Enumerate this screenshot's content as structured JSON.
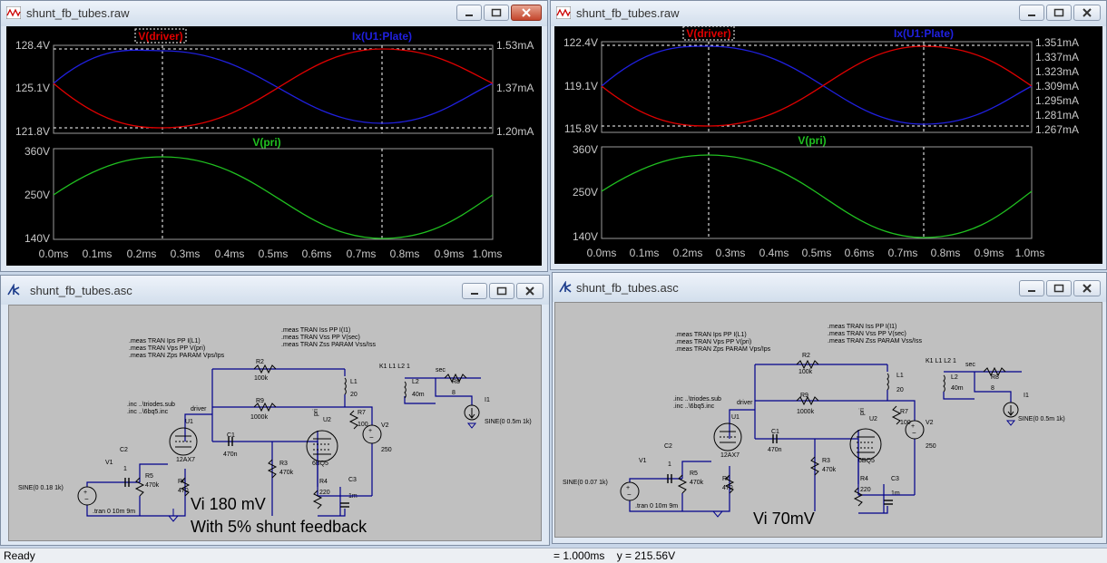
{
  "windows": {
    "wave_left": {
      "title": "shunt_fb_tubes.raw",
      "top": {
        "left_trace": "V(driver)",
        "right_trace": "Ix(U1:Plate)",
        "left_ticks": [
          "128.4V",
          "125.1V",
          "121.8V"
        ],
        "right_ticks": [
          "1.53mA",
          "1.37mA",
          "1.20mA"
        ]
      },
      "bottom": {
        "trace": "V(pri)",
        "left_ticks": [
          "360V",
          "250V",
          "140V"
        ]
      },
      "x_ticks": [
        "0.0ms",
        "0.1ms",
        "0.2ms",
        "0.3ms",
        "0.4ms",
        "0.5ms",
        "0.6ms",
        "0.7ms",
        "0.8ms",
        "0.9ms",
        "1.0ms"
      ]
    },
    "wave_right": {
      "title": "shunt_fb_tubes.raw",
      "top": {
        "left_trace": "V(driver)",
        "right_trace": "Ix(U1:Plate)",
        "left_ticks": [
          "122.4V",
          "119.1V",
          "115.8V"
        ],
        "right_ticks": [
          "1.351mA",
          "1.337mA",
          "1.323mA",
          "1.309mA",
          "1.295mA",
          "1.281mA",
          "1.267mA"
        ]
      },
      "bottom": {
        "trace": "V(pri)",
        "left_ticks": [
          "360V",
          "250V",
          "140V"
        ]
      },
      "x_ticks": [
        "0.0ms",
        "0.1ms",
        "0.2ms",
        "0.3ms",
        "0.4ms",
        "0.5ms",
        "0.6ms",
        "0.7ms",
        "0.8ms",
        "0.9ms",
        "1.0ms"
      ]
    },
    "sch_left": {
      "title": "shunt_fb_tubes.asc",
      "meas1": [
        ".meas TRAN Ips PP I(L1)",
        ".meas TRAN Vps PP V(pri)",
        ".meas TRAN Zps PARAM Vps/Ips"
      ],
      "meas2": [
        ".meas TRAN Iss PP I(I1)",
        ".meas TRAN Vss PP V(sec)",
        ".meas TRAN Zss PARAM Vss/Iss"
      ],
      "inc": [
        ".inc ..\\triodes.sub",
        ".inc ..\\6bq5.inc"
      ],
      "labels": {
        "k1": "K1 L1 L2 1",
        "sec": "sec",
        "driver": "driver",
        "r2": "R2",
        "r2v": "100k",
        "r9": "R9",
        "r9v": "1000k",
        "l1": "L1",
        "l1v": "20",
        "l2": "L2",
        "l2v": "40m",
        "r8": "R8",
        "r8v": "8",
        "i1": "I1",
        "i1v": "SINE(0 0.5m 1k)",
        "u1": "U1",
        "u1v": "12AX7",
        "u2": "U2",
        "u2v": "6BQ5",
        "pri": "pri",
        "r7": "R7",
        "r7v": "100",
        "v2": "V2",
        "v2v": "250",
        "c1": "C1",
        "c1v": "470n",
        "c2": "C2",
        "c2v": "1",
        "r3": "R3",
        "r3v": "470k",
        "r4": "R4",
        "r4v": "220",
        "c3": "C3",
        "c3v": "1m",
        "r5": "R5",
        "r5v": "470k",
        "r6": "R6",
        "r6v": "470",
        "v1": "V1",
        "v1v": "SINE(0 0.18 1k)",
        "tran": ".tran 0 10m 9m"
      },
      "annotation1": "Vi 180 mV",
      "annotation2": "With 5% shunt feedback"
    },
    "sch_right": {
      "title": "shunt_fb_tubes.asc",
      "meas1": [
        ".meas TRAN Ips PP I(L1)",
        ".meas TRAN Vps PP V(pri)",
        ".meas TRAN Zps PARAM Vps/Ips"
      ],
      "meas2": [
        ".meas TRAN Iss PP I(I1)",
        ".meas TRAN Vss PP V(sec)",
        ".meas TRAN Zss PARAM Vss/Iss"
      ],
      "inc": [
        ".inc ..\\triodes.sub",
        ".inc ..\\6bq5.inc"
      ],
      "labels": {
        "k1": "K1 L1 L2 1",
        "sec": "sec",
        "driver": "driver",
        "r2": "R2",
        "r2v": "100k",
        "r9": "R9",
        "r9v": "1000k",
        "l1": "L1",
        "l1v": "20",
        "l2": "L2",
        "l2v": "40m",
        "r8": "R8",
        "r8v": "8",
        "i1": "I1",
        "i1v": "SINE(0 0.5m 1k)",
        "u1": "U1",
        "u1v": "12AX7",
        "u2": "U2",
        "u2v": "6BQ5",
        "pri": "pri",
        "r7": "R7",
        "r7v": "100",
        "v2": "V2",
        "v2v": "250",
        "c1": "C1",
        "c1v": "470n",
        "c2": "C2",
        "c2v": "1",
        "r3": "R3",
        "r3v": "470k",
        "r4": "R4",
        "r4v": "220",
        "c3": "C3",
        "c3v": "1m",
        "r5": "R5",
        "r5v": "470k",
        "r6": "R6",
        "r6v": "470",
        "v1": "V1",
        "v1v": "SINE(0 0.07 1k)",
        "tran": ".tran 0 10m 9m"
      },
      "annotation1": "Vi 70mV"
    }
  },
  "status": {
    "left": "Ready",
    "right": "= 1.000ms    y = 215.56V"
  },
  "colors": {
    "driver": "#e00000",
    "plate": "#2020e0",
    "pri": "#20c020",
    "schematic_wire": "#00008b"
  }
}
